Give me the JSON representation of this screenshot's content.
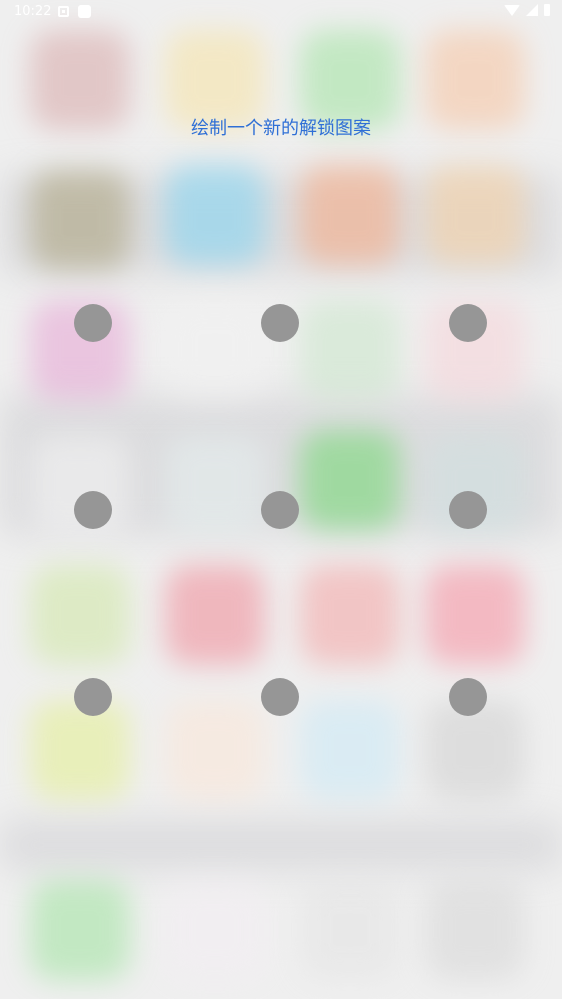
{
  "status_bar": {
    "time": "10:22",
    "left_icons": [
      "notification-icon",
      "app-notification-icon"
    ],
    "right_icons": [
      "wifi-icon",
      "signal-icon",
      "battery-icon"
    ]
  },
  "lock_pattern": {
    "prompt": "绘制一个新的解锁图案",
    "prompt_color": "#2f6fd6",
    "dot_color": "#969696",
    "grid": "3x3",
    "dots": [
      1,
      2,
      3,
      4,
      5,
      6,
      7,
      8,
      9
    ]
  }
}
